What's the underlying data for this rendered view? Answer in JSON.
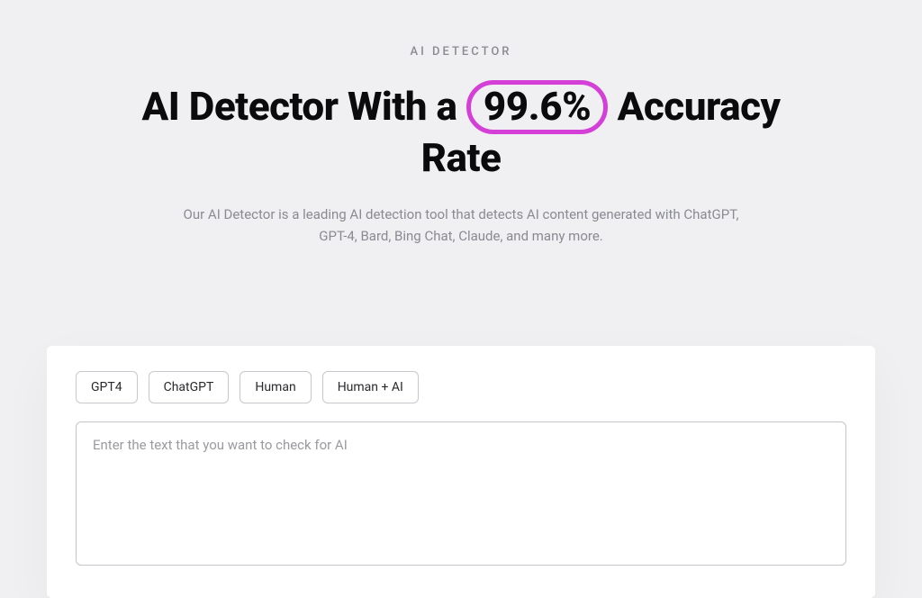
{
  "hero": {
    "eyebrow": "AI DETECTOR",
    "headline_pre": "AI Detector With a ",
    "headline_highlight": "99.6%",
    "headline_post": " Accuracy Rate",
    "subtext": "Our AI Detector is a leading AI detection tool that detects AI content generated with ChatGPT, GPT-4, Bard, Bing Chat, Claude, and many more."
  },
  "tabs": [
    "GPT4",
    "ChatGPT",
    "Human",
    "Human + AI"
  ],
  "input": {
    "placeholder": "Enter the text that you want to check for AI",
    "value": ""
  },
  "colors": {
    "highlight_border": "#d43fd8"
  }
}
